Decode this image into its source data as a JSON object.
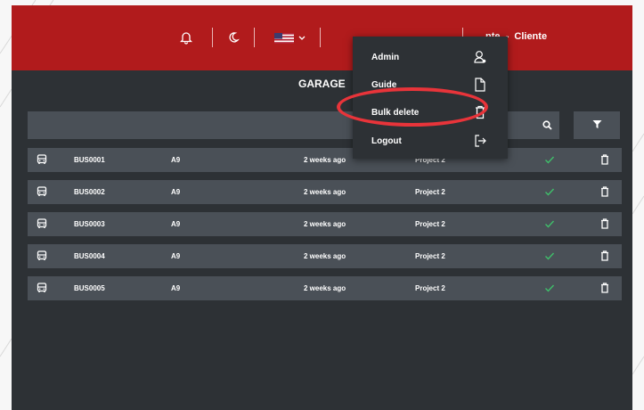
{
  "header": {
    "user_name": "nte  -  Cliente",
    "notification_icon": "bell-icon",
    "theme_icon": "moon-icon",
    "language_icon": "us-flag-icon",
    "language_chevron": "chevron-down-icon",
    "brand_color": "#b11b1c"
  },
  "page": {
    "title": "GARAGE"
  },
  "search": {
    "placeholder": "",
    "search_icon": "search-icon",
    "filter_icon": "filter-icon"
  },
  "rows": [
    {
      "id": "BUS0001",
      "model": "A9",
      "time": "2 weeks ago",
      "project": "Project 2",
      "status": "active"
    },
    {
      "id": "BUS0002",
      "model": "A9",
      "time": "2 weeks ago",
      "project": "Project 2",
      "status": "active"
    },
    {
      "id": "BUS0003",
      "model": "A9",
      "time": "2 weeks ago",
      "project": "Project 2",
      "status": "active"
    },
    {
      "id": "BUS0004",
      "model": "A9",
      "time": "2 weeks ago",
      "project": "Project 2",
      "status": "active"
    },
    {
      "id": "BUS0005",
      "model": "A9",
      "time": "2 weeks ago",
      "project": "Project 2",
      "status": "active"
    }
  ],
  "menu": {
    "items": [
      {
        "label": "Admin",
        "icon": "user-icon"
      },
      {
        "label": "Guide",
        "icon": "document-icon"
      },
      {
        "label": "Bulk delete",
        "icon": "trash-icon"
      },
      {
        "label": "Logout",
        "icon": "logout-icon"
      }
    ],
    "highlight_color": "#e8343a"
  },
  "colors": {
    "check": "#3fbf6a",
    "row_bg": "#4a5057",
    "app_bg": "#2d3135"
  }
}
